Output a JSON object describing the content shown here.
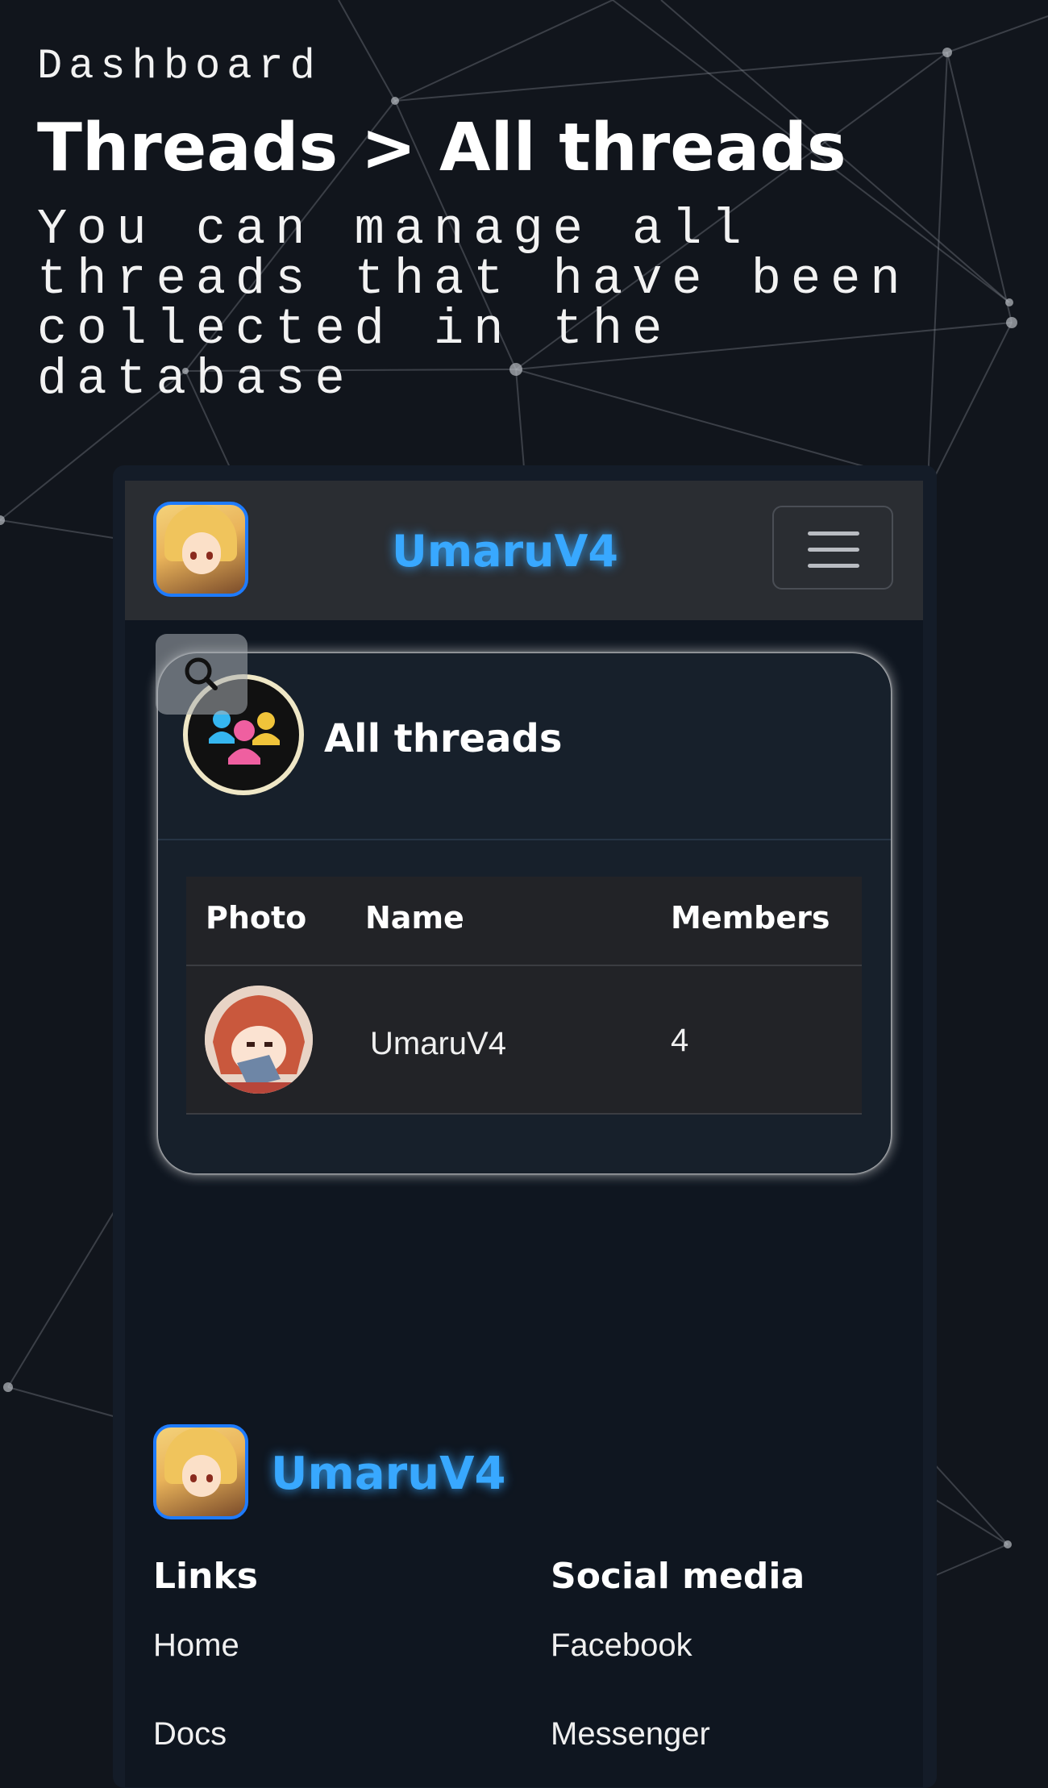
{
  "hero": {
    "kicker": "Dashboard",
    "title": "Threads > All threads",
    "subtitle": "You can manage all threads that have been collected in the database"
  },
  "navbar": {
    "brand": "UmaruV4",
    "menu_icon": "hamburger-menu-icon",
    "logo_icon": "umaru-avatar-icon"
  },
  "card": {
    "title": "All threads",
    "icon": "group-users-icon",
    "search_icon": "search-icon",
    "table": {
      "headers": [
        "Photo",
        "Name",
        "Members"
      ],
      "rows": [
        {
          "photo": "thread-avatar",
          "name": "UmaruV4",
          "members": "4"
        }
      ]
    }
  },
  "footer": {
    "brand": "UmaruV4",
    "links_heading": "Links",
    "links": [
      "Home",
      "Docs"
    ],
    "social_heading": "Social media",
    "social": [
      "Facebook",
      "Messenger"
    ]
  },
  "colors": {
    "page_bg": "#11151c",
    "brand_blue": "#38a8ff",
    "navbar_bg": "#2a2d32",
    "card_bg": "#17202b",
    "table_bg": "#222327"
  }
}
